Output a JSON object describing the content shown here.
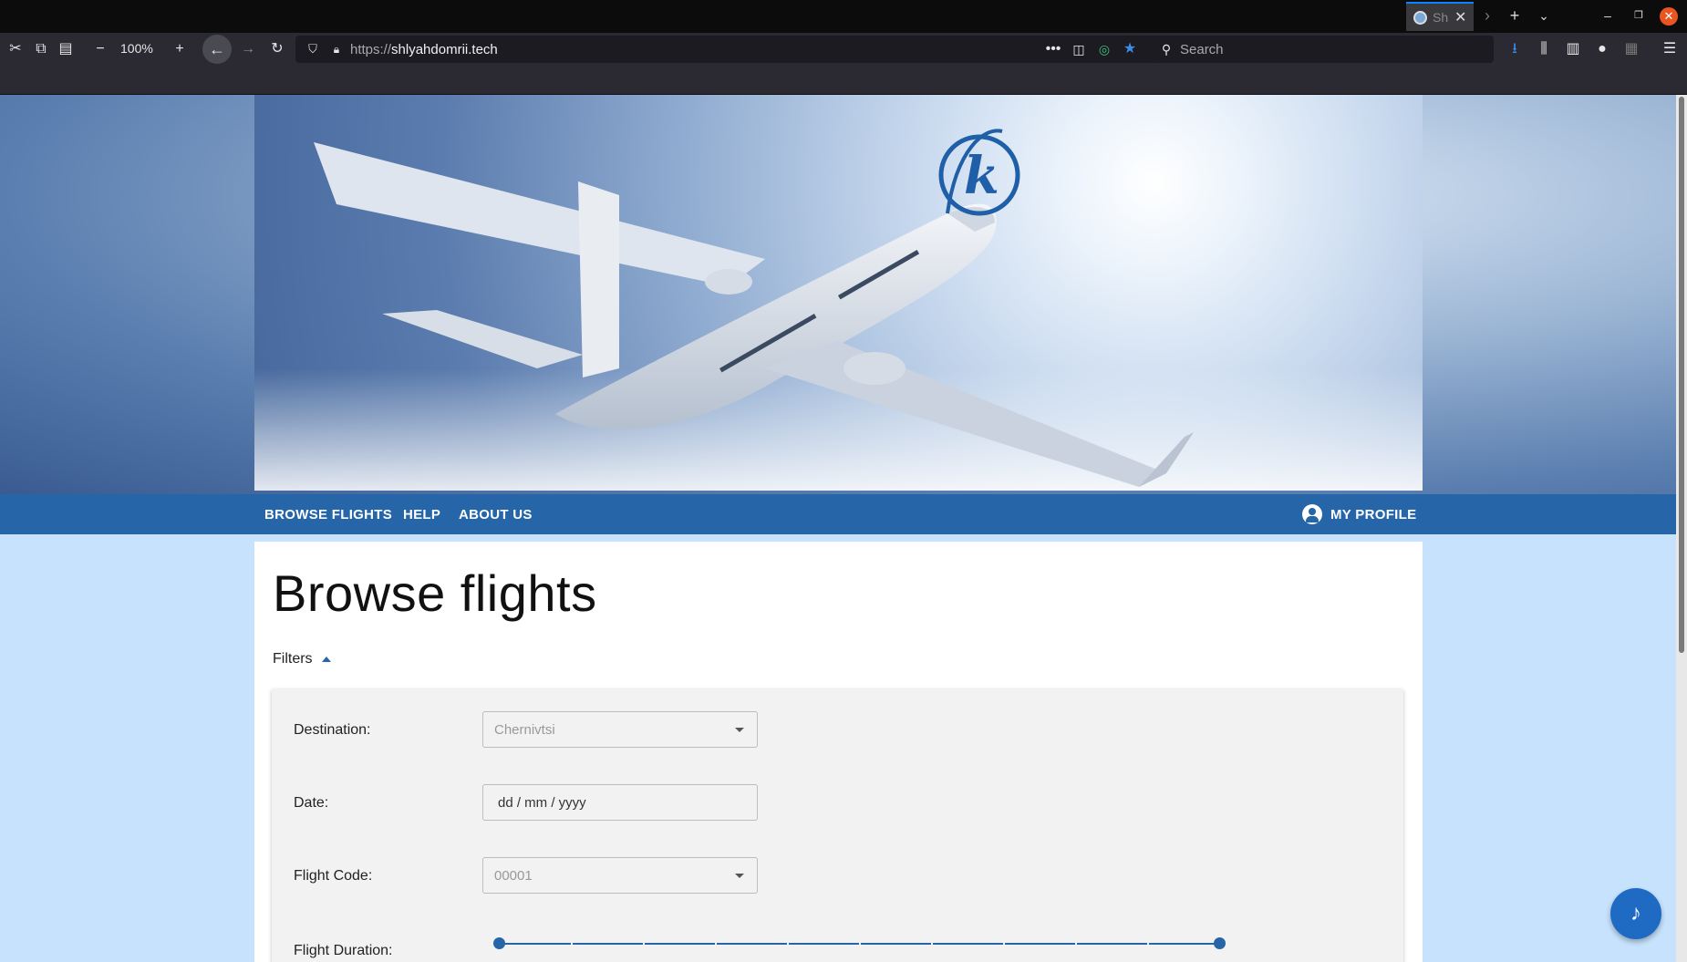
{
  "browser": {
    "tab_title": "Sh",
    "zoom": "100%",
    "url_scheme": "https://",
    "url_host": "shlyahdomrii.tech",
    "search_placeholder": "Search"
  },
  "nav": {
    "links": [
      "BROWSE FLIGHTS",
      "HELP",
      "ABOUT US"
    ],
    "profile_label": "MY PROFILE"
  },
  "page": {
    "title": "Browse flights",
    "filters_label": "Filters"
  },
  "filters": {
    "destination": {
      "label": "Destination:",
      "value": "Chernivtsi"
    },
    "date": {
      "label": "Date:",
      "value": "dd / mm / yyyy"
    },
    "flight_code": {
      "label": "Flight Code:",
      "value": "00001"
    },
    "duration": {
      "label": "Flight Duration:",
      "min_fraction": 0.0,
      "max_fraction": 1.0,
      "ticks": 9
    }
  },
  "colors": {
    "nav_bg": "#2565a8",
    "page_bg": "#c6e2fd",
    "accent": "#1f6ac2"
  },
  "icons": {
    "fab": "music-note-icon",
    "profile": "account-circle-icon",
    "logo": "logo-k-icon"
  }
}
